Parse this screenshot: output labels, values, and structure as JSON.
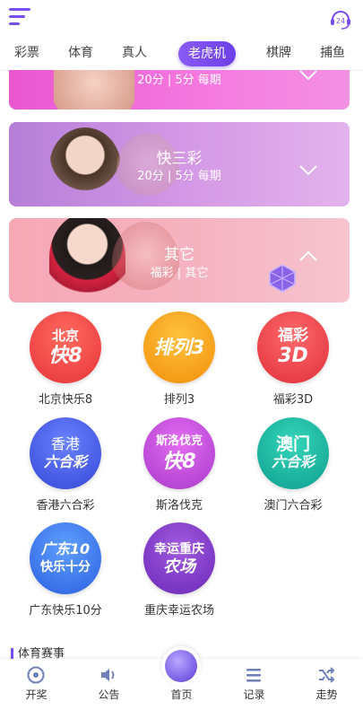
{
  "header": {
    "menu_icon": "hamburger-icon",
    "support_icon": "headset-24-icon",
    "support_badge": "24"
  },
  "tabs": [
    {
      "label": "彩票"
    },
    {
      "label": "体育"
    },
    {
      "label": "真人"
    },
    {
      "label": "老虎机",
      "active": true
    },
    {
      "label": "棋牌"
    },
    {
      "label": "捕鱼"
    }
  ],
  "banners": [
    {
      "title": "",
      "subtitle": "20分 | 5分 每期",
      "chevron": "down",
      "color": "#f06ad6"
    },
    {
      "title": "快三彩",
      "subtitle": "20分 | 5分 每期",
      "chevron": "down",
      "color": "#c28ad8"
    },
    {
      "title": "其它",
      "subtitle": "福彩 | 其它",
      "chevron": "up",
      "color": "#f7a1b4"
    }
  ],
  "games": [
    {
      "label": "北京快乐8",
      "logo": [
        "北京",
        "快8"
      ],
      "color": "#f0453f"
    },
    {
      "label": "排列3",
      "logo": [
        "排列3"
      ],
      "color": "#f7a512"
    },
    {
      "label": "福彩3D",
      "logo": [
        "福彩",
        "3D"
      ],
      "color": "#ee3f48"
    },
    {
      "label": "香港六合彩",
      "logo": [
        "香港",
        "六合彩"
      ],
      "color": "#4a61e8"
    },
    {
      "label": "斯洛伐克",
      "logo": [
        "斯洛伐克",
        "快8"
      ],
      "color": "#c84de0"
    },
    {
      "label": "澳门六合彩",
      "logo": [
        "澳门",
        "六合彩"
      ],
      "color": "#14b8a6"
    },
    {
      "label": "广东快乐10分",
      "logo": [
        "广东10",
        "快乐十分"
      ],
      "color": "#3b7ff0"
    },
    {
      "label": "重庆幸运农场",
      "logo": [
        "幸运重庆",
        "农场"
      ],
      "color": "#8a3fd0"
    }
  ],
  "section_title": "体育赛事",
  "bottom_nav": [
    {
      "label": "开奖",
      "icon": "ball-icon"
    },
    {
      "label": "公告",
      "icon": "speaker-icon"
    },
    {
      "label": "首页",
      "icon": "home-ball-icon"
    },
    {
      "label": "记录",
      "icon": "list-icon"
    },
    {
      "label": "走势",
      "icon": "shuffle-icon"
    }
  ]
}
